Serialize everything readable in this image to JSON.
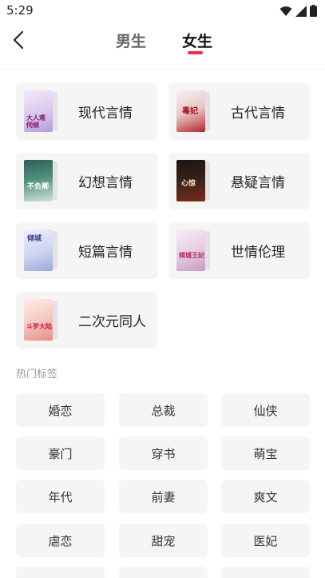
{
  "status_bar": {
    "time": "5:29",
    "icons": [
      "wifi-icon",
      "signal-icon",
      "battery-icon"
    ]
  },
  "nav": {
    "back_icon": "back-arrow-icon",
    "tabs": [
      {
        "label": "男生",
        "active": false
      },
      {
        "label": "女生",
        "active": true
      }
    ],
    "accent_color": "#ea3145"
  },
  "categories": [
    {
      "label": "现代言情",
      "cover_text": "大人难伺候"
    },
    {
      "label": "古代言情",
      "cover_text": "毒妃"
    },
    {
      "label": "幻想言情",
      "cover_text": "不负卿"
    },
    {
      "label": "悬疑言情",
      "cover_text": "心惊"
    },
    {
      "label": "短篇言情",
      "cover_text": "倾城"
    },
    {
      "label": "世情伦理",
      "cover_text": "倾城王妃"
    },
    {
      "label": "二次元同人",
      "cover_text": "斗罗大陆"
    }
  ],
  "hot_tags": {
    "title": "热门标签",
    "tags": [
      "婚恋",
      "总裁",
      "仙侠",
      "豪门",
      "穿书",
      "萌宝",
      "年代",
      "前妻",
      "爽文",
      "虐恋",
      "甜宠",
      "医妃"
    ]
  }
}
